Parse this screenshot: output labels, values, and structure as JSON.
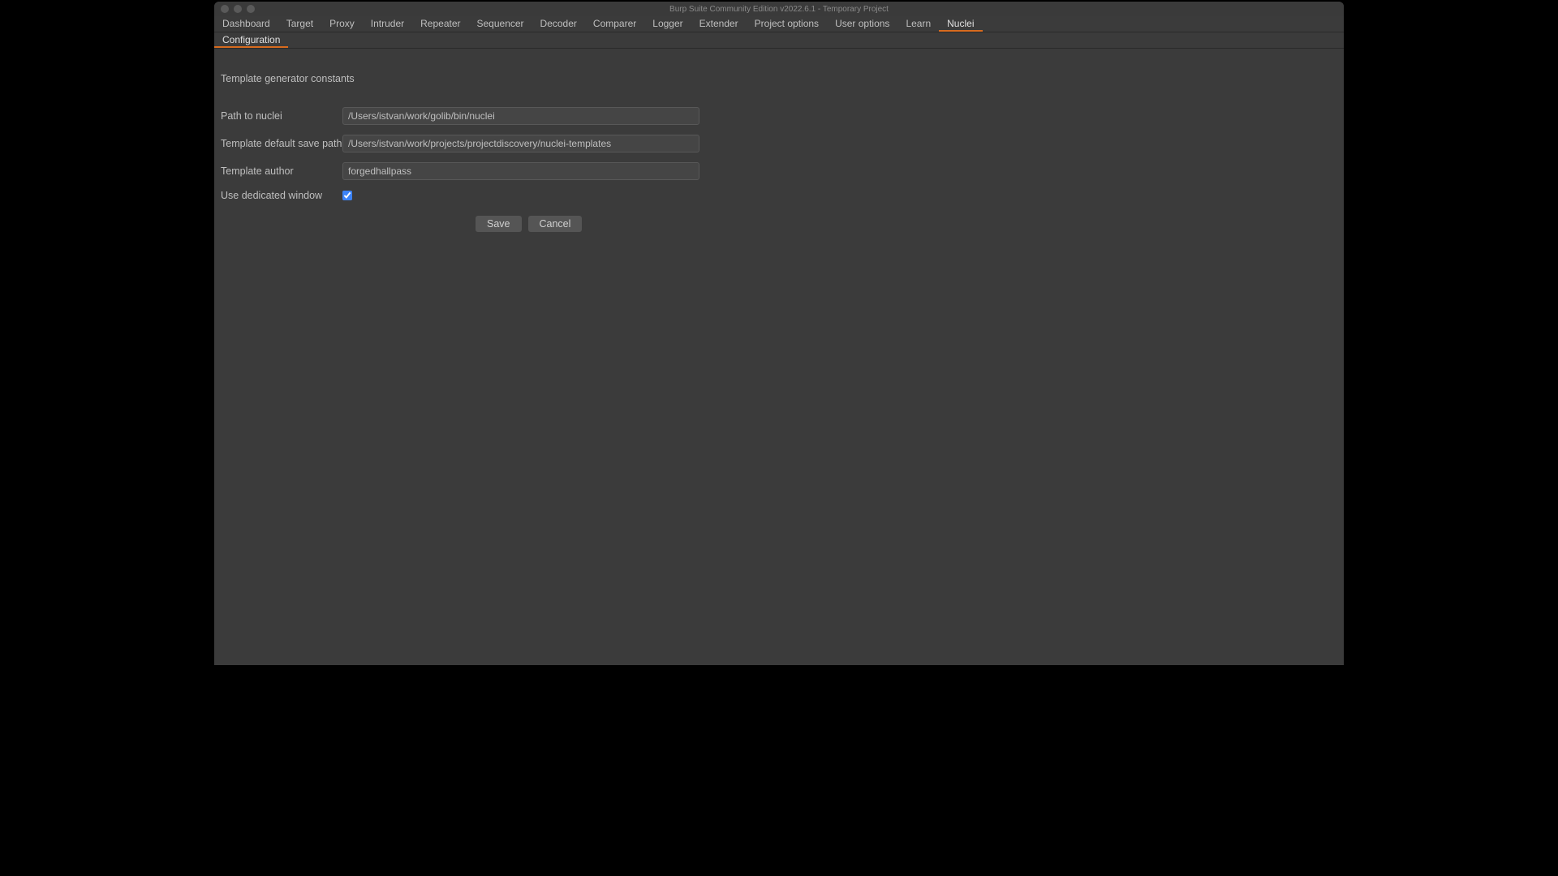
{
  "window": {
    "title": "Burp Suite Community Edition v2022.6.1 - Temporary Project"
  },
  "tabs": {
    "items": [
      {
        "label": "Dashboard"
      },
      {
        "label": "Target"
      },
      {
        "label": "Proxy"
      },
      {
        "label": "Intruder"
      },
      {
        "label": "Repeater"
      },
      {
        "label": "Sequencer"
      },
      {
        "label": "Decoder"
      },
      {
        "label": "Comparer"
      },
      {
        "label": "Logger"
      },
      {
        "label": "Extender"
      },
      {
        "label": "Project options"
      },
      {
        "label": "User options"
      },
      {
        "label": "Learn"
      },
      {
        "label": "Nuclei"
      }
    ],
    "active_index": 13
  },
  "subtabs": {
    "items": [
      {
        "label": "Configuration"
      }
    ],
    "active_index": 0
  },
  "form": {
    "section_title": "Template generator constants",
    "path_to_nuclei": {
      "label": "Path to nuclei",
      "value": "/Users/istvan/work/golib/bin/nuclei"
    },
    "default_save_path": {
      "label": "Template default save path",
      "value": "/Users/istvan/work/projects/projectdiscovery/nuclei-templates"
    },
    "template_author": {
      "label": "Template author",
      "value": "forgedhallpass"
    },
    "use_dedicated_window": {
      "label": "Use dedicated window",
      "checked": true
    },
    "buttons": {
      "save": "Save",
      "cancel": "Cancel"
    }
  }
}
